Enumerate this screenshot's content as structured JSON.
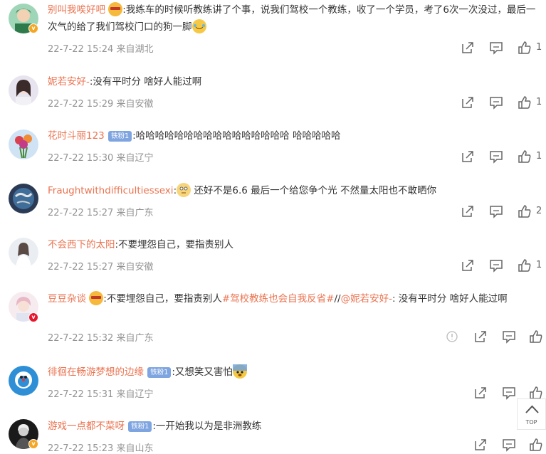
{
  "comments": [
    {
      "user": "别叫我唉好吧",
      "text": ":我练车的时候听教练讲了个事，说我们驾校一个教练，收了一个学员，考了6次一次没过，最后一次气的给了我们驾校门口的狗一脚",
      "time": "22-7-22 15:24 来自湖北",
      "likes": "1"
    },
    {
      "user": "妮若安好-",
      "text": ":没有平时分 啥好人能过啊",
      "time": "22-7-22 15:29 来自安徽",
      "likes": "1"
    },
    {
      "user": "花时斗丽123",
      "fan": "铁粉1",
      "text": ":哈哈哈哈哈哈哈哈哈哈哈哈哈哈哈哈 哈哈哈哈哈",
      "time": "22-7-22 15:30 来自辽宁",
      "likes": "1"
    },
    {
      "user": "Fraughtwithdifficultiessexi",
      "text": " 还好不是6.6 最后一个给您争个光 不然量太阳也不敢晒你",
      "time": "22-7-22 15:27 来自广东",
      "likes": "2"
    },
    {
      "user": "不会西下的太阳",
      "text": ":不要埋怨自己，要指责别人",
      "time": "22-7-22 15:27 来自安徽",
      "likes": "1"
    },
    {
      "user": "豆豆杂谈",
      "text1": ":不要埋怨自己，要指责别人",
      "hashtag": "#驾校教练也会自我反省#",
      "sep": "//",
      "mention": "@妮若安好-",
      "text2": ": 没有平时分 啥好人能过啊",
      "time": "22-7-22 15:32 来自广东"
    },
    {
      "user": "徘徊在畅游梦想的边缘",
      "fan": "铁粉1",
      "text": ":又想笑又害怕",
      "time": "22-7-22 15:31 来自辽宁"
    },
    {
      "user": "游戏一点都不菜呀",
      "fan": "铁粉1",
      "text": ":一开始我以为是非洲教练",
      "time": "22-7-22 15:23 来自山东"
    }
  ],
  "top_button": "TOP",
  "colors": {
    "username": "#eb7350",
    "meta": "#939393",
    "fan_badge": "#7fa5e0"
  }
}
